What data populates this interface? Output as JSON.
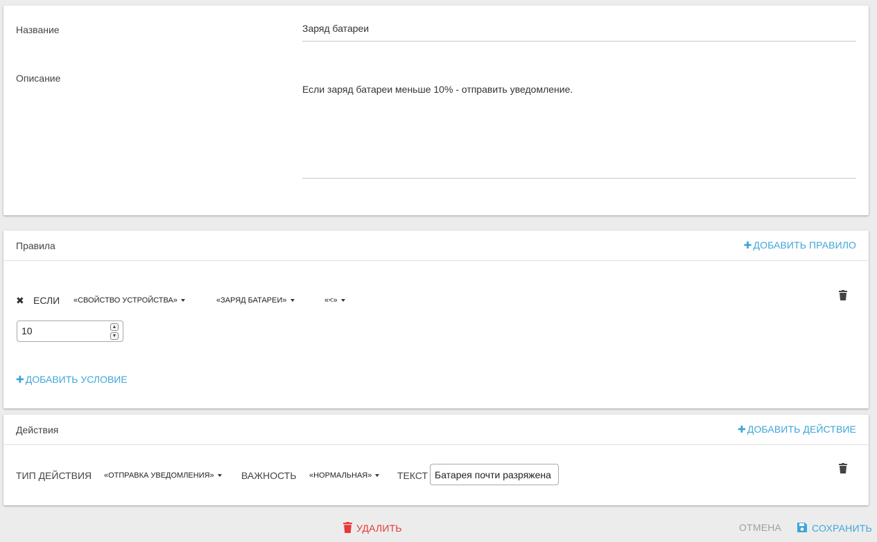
{
  "info": {
    "name_label": "Название",
    "name_value": "Заряд батареи",
    "description_label": "Описание",
    "description_value": "Если заряд батареи меньше 10% - отправить уведомление."
  },
  "rules": {
    "title": "Правила",
    "add_rule": "ДОБАВИТЬ ПРАВИЛО",
    "if_label": "ЕСЛИ",
    "property_dropdown": "«СВОЙСТВО УСТРОЙСТВА»",
    "battery_dropdown": "«ЗАРЯД БАТАРЕИ»",
    "operator_dropdown": "«<»",
    "value": "10",
    "add_condition": "ДОБАВИТЬ УСЛОВИЕ"
  },
  "actions": {
    "title": "Действия",
    "add_action": "ДОБАВИТЬ ДЕЙСТВИЕ",
    "type_label": "ТИП ДЕЙСТВИЯ",
    "type_dropdown": "«ОТПРАВКА УВЕДОМЛЕНИЯ»",
    "severity_label": "ВАЖНОСТЬ",
    "severity_dropdown": "«НОРМАЛЬНАЯ»",
    "text_label": "ТЕКСТ",
    "text_value": "Батарея почти разряжена"
  },
  "footer": {
    "delete": "УДАЛИТЬ",
    "cancel": "ОТМЕНА",
    "save": "СОХРАНИТЬ"
  },
  "colors": {
    "accent": "#3ea6d8",
    "danger": "#e53935",
    "muted": "#9e9e9e"
  }
}
